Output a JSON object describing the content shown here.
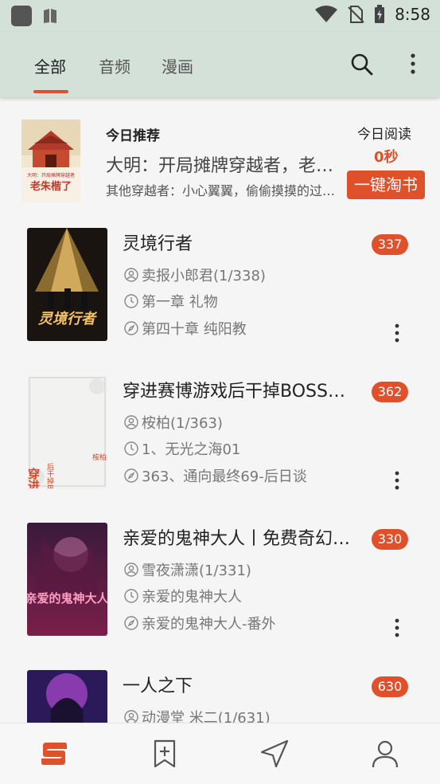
{
  "status": {
    "time": "8:58"
  },
  "tabs": [
    {
      "label": "全部",
      "active": true
    },
    {
      "label": "音频",
      "active": false
    },
    {
      "label": "漫画",
      "active": false
    }
  ],
  "accent": "#e0502a",
  "recommend": {
    "label": "今日推荐",
    "title": "大明：开局摊牌穿越者，老朱麻了",
    "desc": "其他穿越者：小心翼翼，偷偷摸摸的过日子",
    "cover_text": "老朱楷了",
    "cover_small": "大明：开局摊牌穿越者",
    "reading_label": "今日阅读",
    "reading_time": "0秒",
    "button": "一键淘书"
  },
  "books": [
    {
      "title": "灵境行者",
      "count": "337",
      "author": "卖报小郎君(1/338)",
      "last_read": "第一章 礼物",
      "latest": "第四十章 纯阳教",
      "cover_text": "灵境行者"
    },
    {
      "title": "穿进赛博游戏后干掉BOSS成功上位",
      "count": "362",
      "author": "桉柏(1/363)",
      "last_read": "1、无光之海01",
      "latest": "363、通向最终69-后日谈",
      "cover_text": "穿进赛博游",
      "cover_sub": "后干掉BOSS成功上位",
      "cover_author": "桉柏"
    },
    {
      "title": "亲爱的鬼神大人丨免费奇幻恋爱",
      "count": "330",
      "author": "雪夜潇潇(1/331)",
      "last_read": "亲爱的鬼神大人",
      "latest": "亲爱的鬼神大人-番外",
      "cover_text": "亲爱的鬼神大人"
    },
    {
      "title": "一人之下",
      "count": "630",
      "author": "动漫堂 米二(1/631)",
      "last_read": "",
      "latest": "",
      "cover_text": ""
    }
  ],
  "bottom_nav": [
    {
      "icon": "bookshelf-icon",
      "active": true
    },
    {
      "icon": "add-book-icon",
      "active": false
    },
    {
      "icon": "discover-icon",
      "active": false
    },
    {
      "icon": "profile-icon",
      "active": false
    }
  ]
}
